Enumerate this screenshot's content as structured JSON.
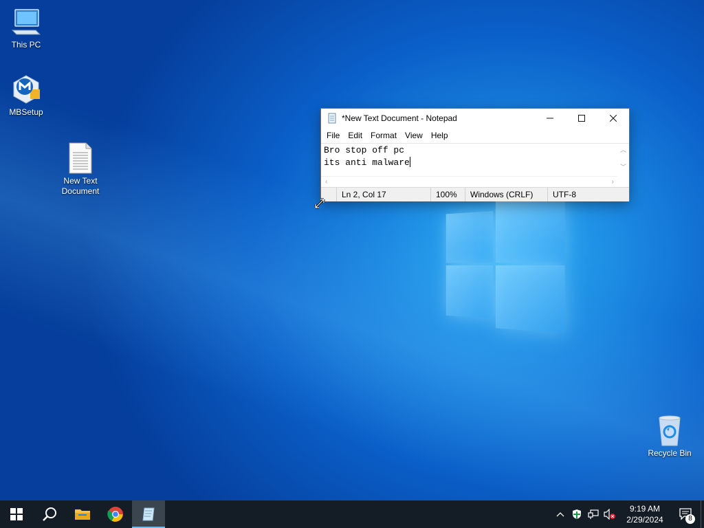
{
  "desktop": {
    "icons": [
      {
        "label": "This PC",
        "icon": "computer-icon"
      },
      {
        "label": "MBSetup",
        "icon": "malwarebytes-icon"
      },
      {
        "label_line1": "New Text",
        "label_line2": "Document",
        "icon": "text-file-icon"
      },
      {
        "label": "Recycle Bin",
        "icon": "recycle-bin-icon"
      }
    ]
  },
  "notepad": {
    "title": "*New Text Document - Notepad",
    "menu": [
      "File",
      "Edit",
      "Format",
      "View",
      "Help"
    ],
    "content_line1": "Bro stop off pc",
    "content_line2": "its anti malware",
    "status": {
      "position": "Ln 2, Col 17",
      "zoom": "100%",
      "line_ending": "Windows (CRLF)",
      "encoding": "UTF-8"
    }
  },
  "taskbar": {
    "pinned": [
      "start-icon",
      "search-icon",
      "file-explorer-icon",
      "chrome-icon",
      "notepad-icon"
    ],
    "time": "9:19 AM",
    "date": "2/29/2024",
    "notification_count": "8"
  },
  "colors": {
    "taskbar": "#141c25",
    "desktop_blue": "#0a5fc8",
    "active_indicator": "#76b9ed"
  }
}
